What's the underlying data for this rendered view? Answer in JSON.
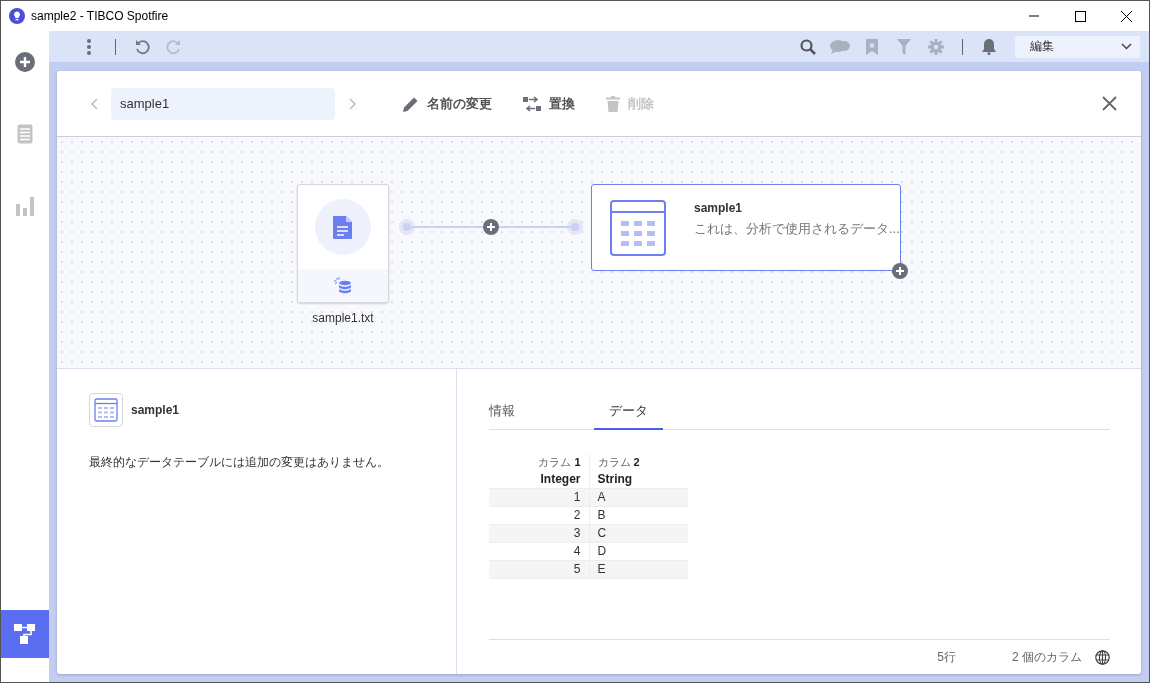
{
  "window": {
    "title": "sample2 - TIBCO Spotfire"
  },
  "sidebar": {
    "items": [
      {
        "kind": "add",
        "selected": false,
        "disabled": false
      },
      {
        "kind": "page",
        "selected": false,
        "disabled": true
      },
      {
        "kind": "chart",
        "selected": false,
        "disabled": true
      },
      {
        "kind": "flow",
        "selected": true,
        "disabled": false
      }
    ]
  },
  "toolbar": {
    "mode": "編集"
  },
  "header": {
    "name_value": "sample1",
    "actions": [
      {
        "kind": "rename",
        "label": "名前の変更",
        "disabled": false
      },
      {
        "kind": "replace",
        "label": "置換",
        "disabled": false
      },
      {
        "kind": "delete",
        "label": "削除",
        "disabled": true
      }
    ]
  },
  "flow": {
    "source": {
      "label": "sample1.txt"
    },
    "table": {
      "title": "sample1",
      "description": "これは、分析で使用されるデータ..."
    }
  },
  "details": {
    "title": "sample1",
    "message": "最終的なデータテーブルには追加の変更はありません。"
  },
  "tabs": [
    {
      "label": "情報",
      "selected": false
    },
    {
      "label": "データ",
      "selected": true
    }
  ],
  "preview": {
    "columns": [
      {
        "name": "カラム **1**",
        "type": "Integer",
        "kind": "number"
      },
      {
        "name": "カラム **2**",
        "type": "String",
        "kind": "text"
      }
    ],
    "rows": [
      [
        "1",
        "A"
      ],
      [
        "2",
        "B"
      ],
      [
        "3",
        "C"
      ],
      [
        "4",
        "D"
      ],
      [
        "5",
        "E"
      ]
    ]
  },
  "status": {
    "rows": "5行",
    "columns": "2 個のカラム"
  }
}
